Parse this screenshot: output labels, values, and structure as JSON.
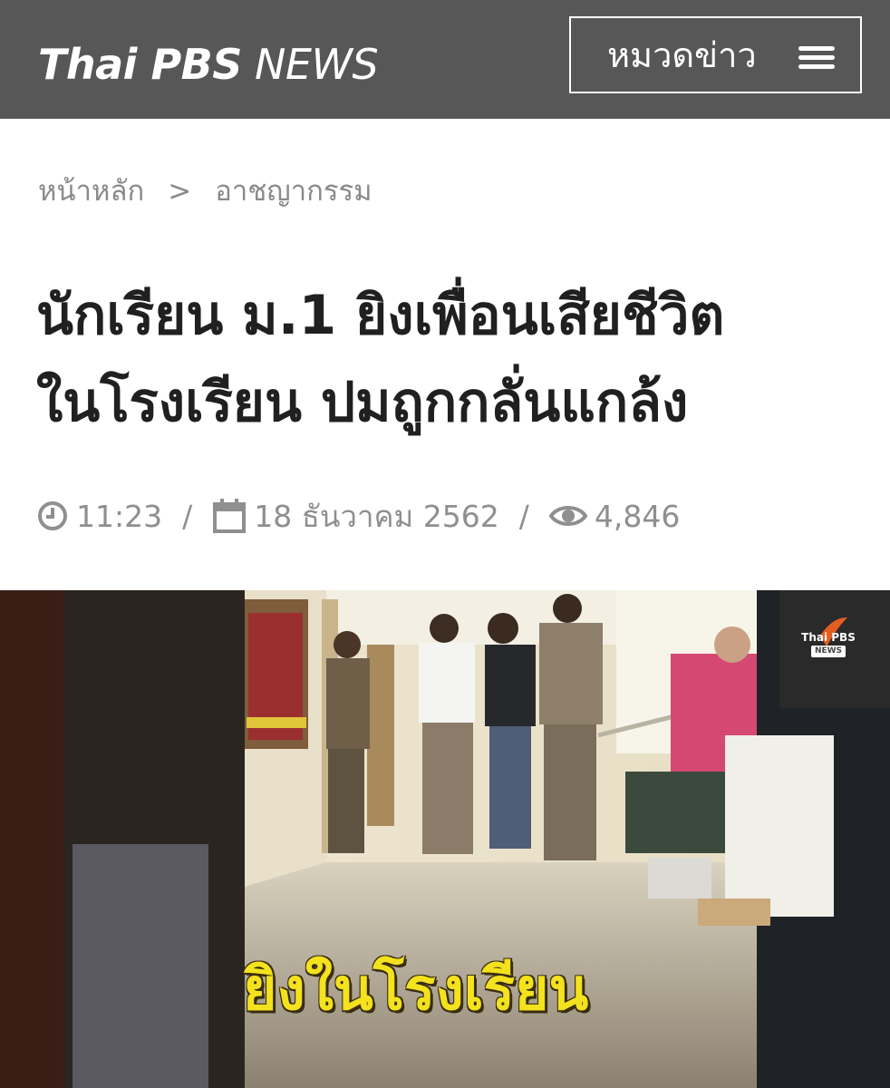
{
  "header": {
    "logo_bold": "Thai PBS",
    "logo_light": " NEWS",
    "menu_label": "หมวดข่าว"
  },
  "breadcrumb": {
    "home": "หน้าหลัก",
    "separator": ">",
    "category": "อาชญากรรม"
  },
  "article": {
    "headline_line1": "นักเรียน ม.1 ยิงเพื่อนเสียชีวิต",
    "headline_line2": "ในโรงเรียน ปมถูกกลั่นแกล้ง",
    "time": "11:23",
    "date": "18 ธันวาคม 2562",
    "views": "4,846",
    "meta_separator": "/"
  },
  "image": {
    "caption": "ยิงในโรงเรียน",
    "watermark_brand": "Thai PBS",
    "watermark_tag": "NEWS"
  },
  "colors": {
    "header_bg": "#575757",
    "text_dark": "#202020",
    "text_meta": "#8f8f8f",
    "caption_yellow": "#f3e21d"
  },
  "icons": [
    "menu-icon",
    "clock-icon",
    "calendar-icon",
    "eye-icon"
  ]
}
